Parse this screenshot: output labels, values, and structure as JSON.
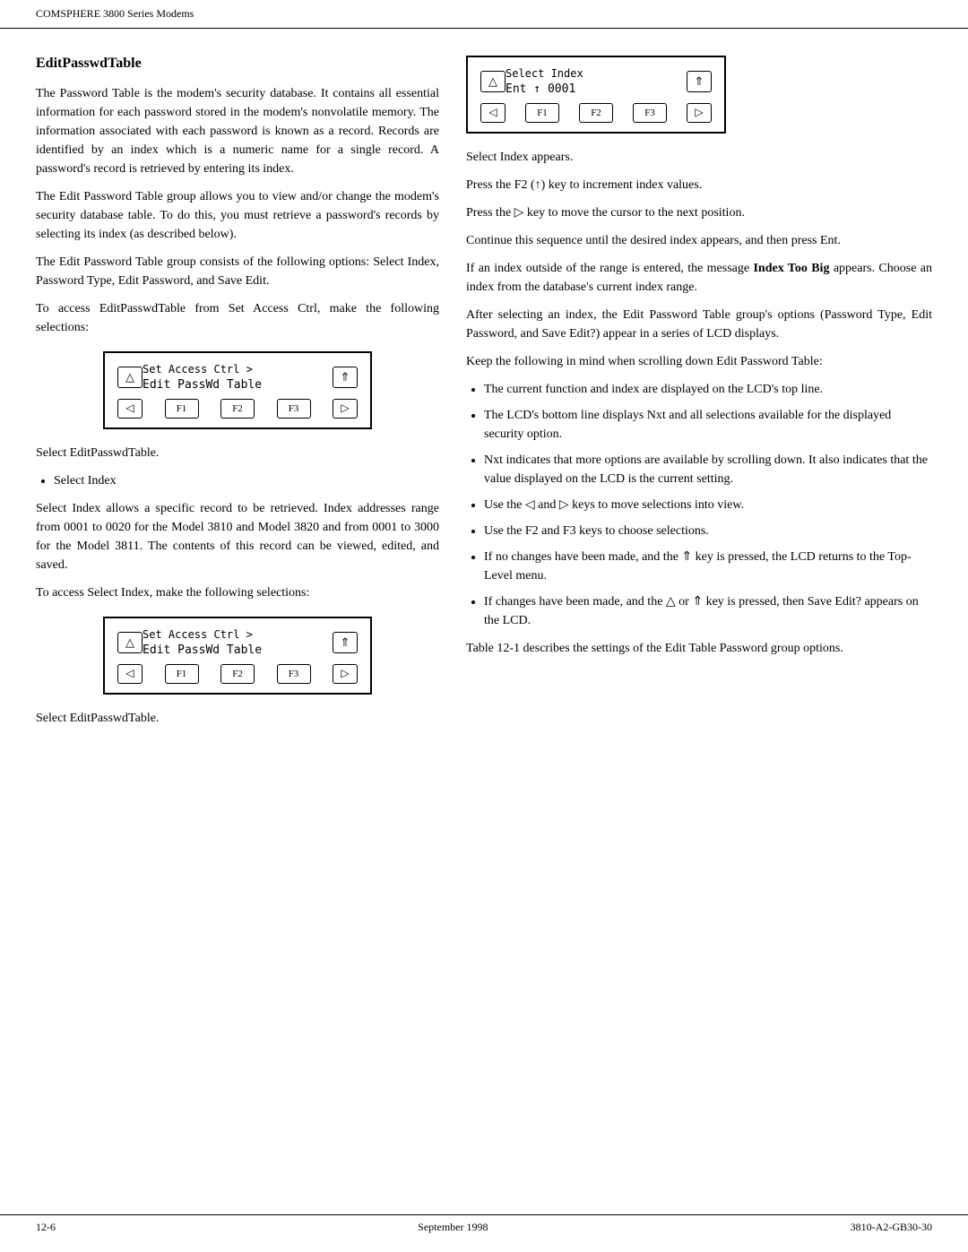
{
  "header": {
    "title": "COMSPHERE 3800 Series Modems"
  },
  "footer": {
    "left": "12-6",
    "center": "September 1998",
    "right": "3810-A2-GB30-30"
  },
  "left": {
    "section_title": "EditPasswdTable",
    "paragraphs": [
      "The Password Table is the modem's security database. It contains all essential information for each password stored in the modem's nonvolatile memory. The information associated with each password is known as a record. Records are identified by an index which is a numeric name for a single record. A password's record is retrieved by entering its index.",
      "The Edit Password Table group allows you to view and/or change the modem's security database table. To do this, you must retrieve a password's records by selecting its index (as described below).",
      "The Edit Password Table group consists of the following options: Select Index, Password Type, Edit Password, and Save Edit.",
      "To access EditPasswdTable from Set Access Ctrl, make the following selections:"
    ],
    "lcd1": {
      "line1": "Set Access Ctrl   >",
      "line2": "Edit PassWd Table",
      "up_arrow": "△",
      "up_home": "⇑",
      "back_arrow": "◁",
      "f1": "F1",
      "f2": "F2",
      "f3": "F3",
      "fwd_arrow": "▷"
    },
    "after_lcd1": "Select EditPasswdTable.",
    "bullet1": "Select Index",
    "para_select_index": "Select Index allows a specific record to be retrieved. Index addresses range from 0001 to 0020 for the Model 3810 and Model 3820 and from 0001 to 3000 for the Model 3811. The contents of this record can be viewed, edited, and saved.",
    "para_to_access": "To access Select Index, make the following selections:",
    "lcd2": {
      "line1": "Set Access Ctrl   >",
      "line2": "Edit PassWd Table",
      "up_arrow": "△",
      "up_home": "⇑",
      "back_arrow": "◁",
      "f1": "F1",
      "f2": "F2",
      "f3": "F3",
      "fwd_arrow": "▷"
    },
    "after_lcd2": "Select EditPasswdTable."
  },
  "right": {
    "lcd_select": {
      "line1": "Select Index",
      "line2": "Ent   ↑ 0001",
      "up_arrow": "△",
      "up_home": "⇑",
      "back_arrow": "◁",
      "f1": "F1",
      "f2": "F2",
      "f3": "F3",
      "fwd_arrow": "▷"
    },
    "para1": "Select Index appears.",
    "para2": "Press the F2 (↑) key to increment index values.",
    "para3": "Press the ▷  key to move the cursor to the next position.",
    "para4": "Continue this sequence until the desired index appears, and then press Ent.",
    "para5": "If an index outside of the range is entered, the message Index Too Big appears. Choose an index from the database's current index range.",
    "para6": "After selecting an index, the Edit Password Table group's options (Password Type, Edit Password, and Save Edit?) appear in a series of LCD displays.",
    "para7": "Keep the following in mind when scrolling down Edit Password Table:",
    "bullets": [
      "The current function and index are displayed on the LCD's top line.",
      "The LCD's bottom line displays Nxt and all selections available for the displayed security option.",
      "Nxt indicates that more options are available by scrolling down. It also indicates that the value displayed on the LCD is the current setting.",
      "Use the ◁ and ▷ keys to move selections into view.",
      "Use the F2 and F3 keys to choose selections.",
      "If no changes have been made, and the ⇑ key is pressed, the LCD returns to the Top-Level menu.",
      "If changes have been made, and the △ or ⇑ key is pressed, then Save Edit? appears on the LCD."
    ],
    "para_last": "Table 12-1 describes the settings of the Edit Table Password group options.",
    "index_too_big_label": "Index Too Big"
  }
}
